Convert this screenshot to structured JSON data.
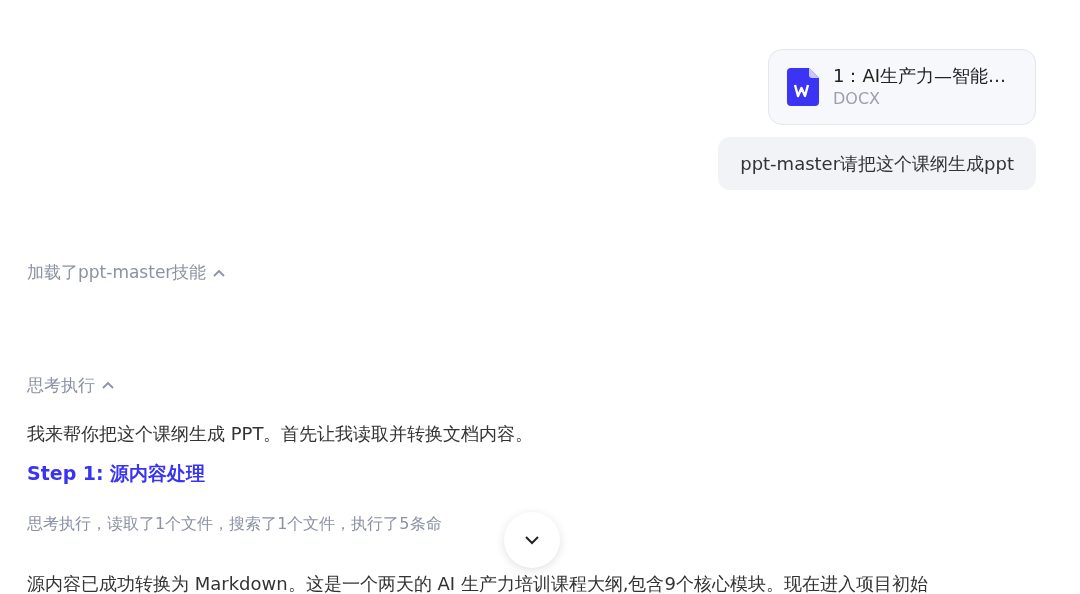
{
  "attachment": {
    "name": "1：AI生产力—智能…",
    "type": "DOCX"
  },
  "user_message": "ppt-master请把这个课纲生成ppt",
  "sections": [
    {
      "kind": "toggle",
      "label": "加载了ppt-master技能",
      "expanded": true
    },
    {
      "kind": "toggle",
      "label": "思考执行",
      "expanded": true
    },
    {
      "kind": "text",
      "text": "我来帮你把这个课纲生成 PPT。首先让我读取并转换文档内容。"
    },
    {
      "kind": "heading",
      "text": "Step 1: 源内容处理"
    },
    {
      "kind": "summary",
      "text": "思考执行，读取了1个文件，搜索了1个文件，执行了5条命"
    },
    {
      "kind": "text",
      "text": "源内容已成功转换为 Markdown。这是一个两天的 AI 生产力培训课程大纲,包含9个核心模块。现在进入项目初始"
    }
  ],
  "scroll_button": {
    "kind": "down"
  }
}
